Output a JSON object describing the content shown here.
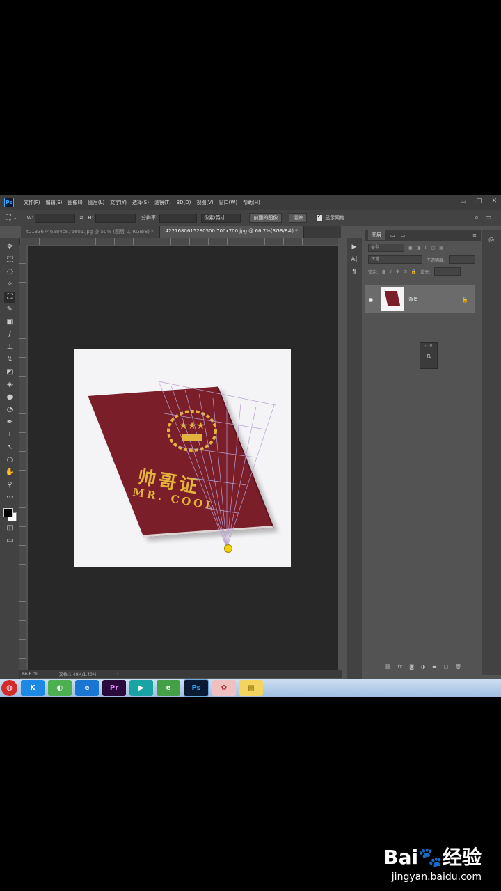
{
  "menu": {
    "logo": "Ps",
    "items": [
      "文件(F)",
      "编辑(E)",
      "图像(I)",
      "图层(L)",
      "文字(Y)",
      "选择(S)",
      "滤镜(T)",
      "3D(D)",
      "视图(V)",
      "窗口(W)",
      "帮助(H)"
    ],
    "window_controls": [
      "▭",
      "▢",
      "✕"
    ]
  },
  "options": {
    "w_label": "W:",
    "h_label": "H:",
    "resolution_label": "分辨率:",
    "unit": "像素/英寸",
    "front_image_btn": "前面的图像",
    "clear_btn": "清除",
    "show_grid_label": "显示网格"
  },
  "tabs": [
    {
      "label": "t01336746584c876e01.jpg @ 50% (图层 0, RGB/8) *",
      "active": false
    },
    {
      "label": "4227680615280500.700x700.jpg @ 66.7%(RGB/8#) *",
      "active": true
    }
  ],
  "canvas": {
    "book_title": "帅哥证",
    "book_subtitle": "MR. COOL",
    "colors": {
      "book": "#7a1f2a",
      "gold": "#e2b338",
      "paper": "#f4f4f6"
    }
  },
  "status": {
    "zoom": "66.67%",
    "doc_info": "文档:1.40M/1.40M"
  },
  "layers_panel": {
    "tab_label": "图层",
    "search_placeholder": "类型",
    "blend_mode": "正常",
    "opacity_label": "不透明度:",
    "lock_label": "锁定:",
    "fill_label": "填充:",
    "layer_name": "背景"
  },
  "watermark": {
    "logo": "Bai🐾经验",
    "url": "jingyan.baidu.com"
  }
}
